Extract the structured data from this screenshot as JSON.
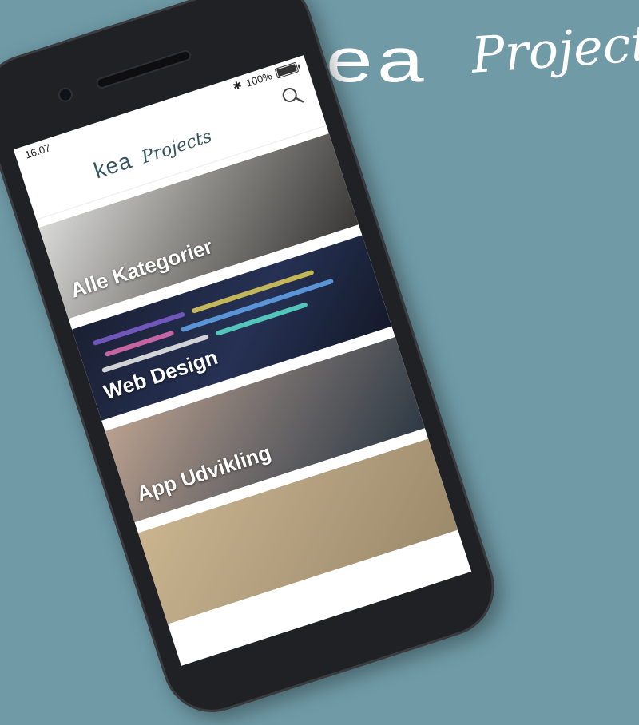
{
  "brand": {
    "kea": "kea",
    "projects": "Projects"
  },
  "phone": {
    "status": {
      "time": "16.07",
      "battery_text": "100%",
      "battery_level": 1.0
    },
    "header": {
      "logo_kea": "kea",
      "logo_projects": "Projects",
      "search_icon": "search-icon"
    },
    "categories": [
      {
        "label": "Alle Kategorier"
      },
      {
        "label": "Web Design"
      },
      {
        "label": "App Udvikling"
      },
      {
        "label": ""
      }
    ]
  },
  "colors": {
    "background": "#6f9aa6",
    "phone_body": "#202124",
    "screen": "#ffffff",
    "logo_text": "#35565f",
    "label_text": "#ffffff"
  }
}
